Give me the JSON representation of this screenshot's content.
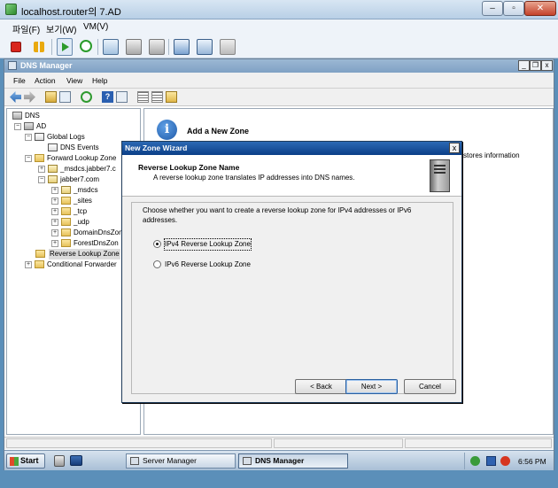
{
  "vm": {
    "title": "localhost.router의 7.AD",
    "menu": [
      "파일(F)",
      "보기(W)",
      "VM(V)"
    ],
    "window_controls": {
      "minimize": "–",
      "maximize": "▫",
      "close": "✕"
    }
  },
  "mmc": {
    "title": "DNS Manager",
    "menu": [
      "File",
      "Action",
      "View",
      "Help"
    ],
    "window_controls": {
      "minimize": "_",
      "restore": "❐",
      "close": "x"
    }
  },
  "tree": {
    "dns": "DNS",
    "ad": "AD",
    "global_logs": "Global Logs",
    "dns_events": "DNS Events",
    "forward_lookup": "Forward Lookup Zone",
    "msdcs_jabber7": "_msdcs.jabber7.c",
    "jabber7": "jabber7.com",
    "msdcs": "_msdcs",
    "sites": "_sites",
    "tcp": "_tcp",
    "udp": "_udp",
    "domaindns": "DomainDnsZone",
    "forestdns": "ForestDnsZon",
    "reverse_lookup": "Reverse Lookup Zone",
    "conditional_forwarders": "Conditional Forwarder"
  },
  "right": {
    "icon_glyph": "i",
    "title": "Add a New Zone",
    "info_text": "stores information"
  },
  "taskbar": {
    "start": "Start",
    "items": [
      "Server Manager",
      "DNS Manager"
    ],
    "clock": "6:56 PM"
  },
  "wizard": {
    "title": "New Zone Wizard",
    "close": "x",
    "header_title": "Reverse Lookup Zone Name",
    "header_subtitle": "A reverse lookup zone translates IP addresses into DNS names.",
    "prompt": "Choose whether you want to create a reverse lookup zone for IPv4 addresses or IPv6 addresses.",
    "options": [
      {
        "label": "IPv4 Reverse Lookup Zone",
        "selected": true
      },
      {
        "label": "IPv6 Reverse Lookup Zone",
        "selected": false
      }
    ],
    "buttons": {
      "back": "< Back",
      "next": "Next >",
      "cancel": "Cancel"
    }
  },
  "colors": {
    "wizard_title": "#0b3f87",
    "mmc_title": "#7fa1c4",
    "taskbar": "#a9bfd6"
  }
}
